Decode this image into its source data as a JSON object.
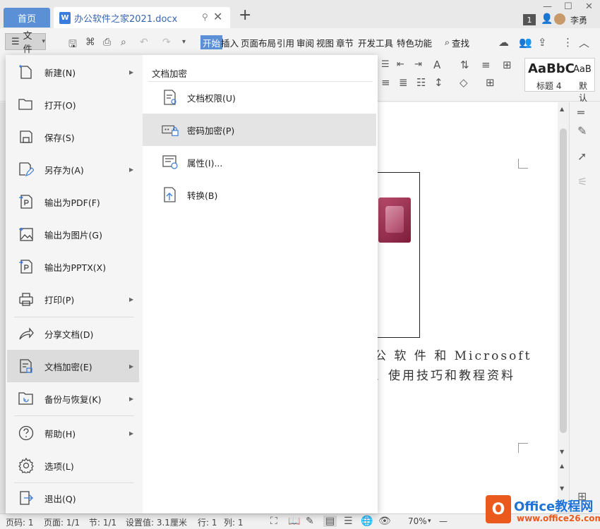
{
  "titlebar": {
    "home_tab": "首页",
    "doc_tab": "办公软件之家2021.docx",
    "doc_icon_letter": "W",
    "new_tab": "+",
    "page_badge": "1",
    "username": "李勇"
  },
  "ribbon": {
    "file_label": "文件",
    "tabs": [
      "开始",
      "插入",
      "页面布局",
      "引用",
      "审阅",
      "视图",
      "章节",
      "开发工具",
      "特色功能"
    ],
    "search_label": "查找",
    "styles": {
      "big": "AaBbC",
      "big2": "AaB",
      "label1": "标题 4",
      "label2": "默认"
    }
  },
  "file_menu": {
    "items": [
      {
        "label": "新建(N)",
        "icon": "new-doc-icon"
      },
      {
        "label": "打开(O)",
        "icon": "folder-open-icon"
      },
      {
        "label": "保存(S)",
        "icon": "save-icon"
      },
      {
        "label": "另存为(A)",
        "icon": "save-as-icon"
      },
      {
        "label": "输出为PDF(F)",
        "icon": "export-pdf-icon"
      },
      {
        "label": "输出为图片(G)",
        "icon": "export-image-icon"
      },
      {
        "label": "输出为PPTX(X)",
        "icon": "export-pptx-icon"
      },
      {
        "label": "打印(P)",
        "icon": "print-icon"
      },
      {
        "label": "分享文档(D)",
        "icon": "share-icon"
      },
      {
        "label": "文档加密(E)",
        "icon": "encrypt-doc-icon"
      },
      {
        "label": "备份与恢复(K)",
        "icon": "backup-icon"
      },
      {
        "label": "帮助(H)",
        "icon": "help-icon"
      },
      {
        "label": "选项(L)",
        "icon": "options-icon"
      },
      {
        "label": "退出(Q)",
        "icon": "exit-icon"
      }
    ],
    "active_item": "文档加密(E)"
  },
  "submenu": {
    "title": "文档加密",
    "items": [
      {
        "label": "文档权限(U)",
        "icon": "doc-permission-icon"
      },
      {
        "label": "密码加密(P)",
        "icon": "password-encrypt-icon"
      },
      {
        "label": "属性(I)...",
        "icon": "properties-icon"
      },
      {
        "label": "转换(B)",
        "icon": "convert-icon"
      }
    ],
    "active_item": "密码加密(P)"
  },
  "document": {
    "line1": "公 软 件 和 Microsoft",
    "line2": "、使用技巧和教程资料"
  },
  "statusbar": {
    "page_num": "页码: 1",
    "page_total": "页面: 1/1",
    "section": "节: 1/1",
    "settings": "设置值: 3.1厘米",
    "row": "行: 1",
    "col": "列: 1",
    "zoom": "70%"
  },
  "watermark": {
    "logo_letter": "O",
    "title": "Office教程网",
    "url": "www.office26.com"
  },
  "colors": {
    "accent": "#5b8fd6",
    "menu_active": "#dcdcdc",
    "watermark_orange": "#ea5a1d",
    "watermark_blue": "#1f73d6"
  }
}
